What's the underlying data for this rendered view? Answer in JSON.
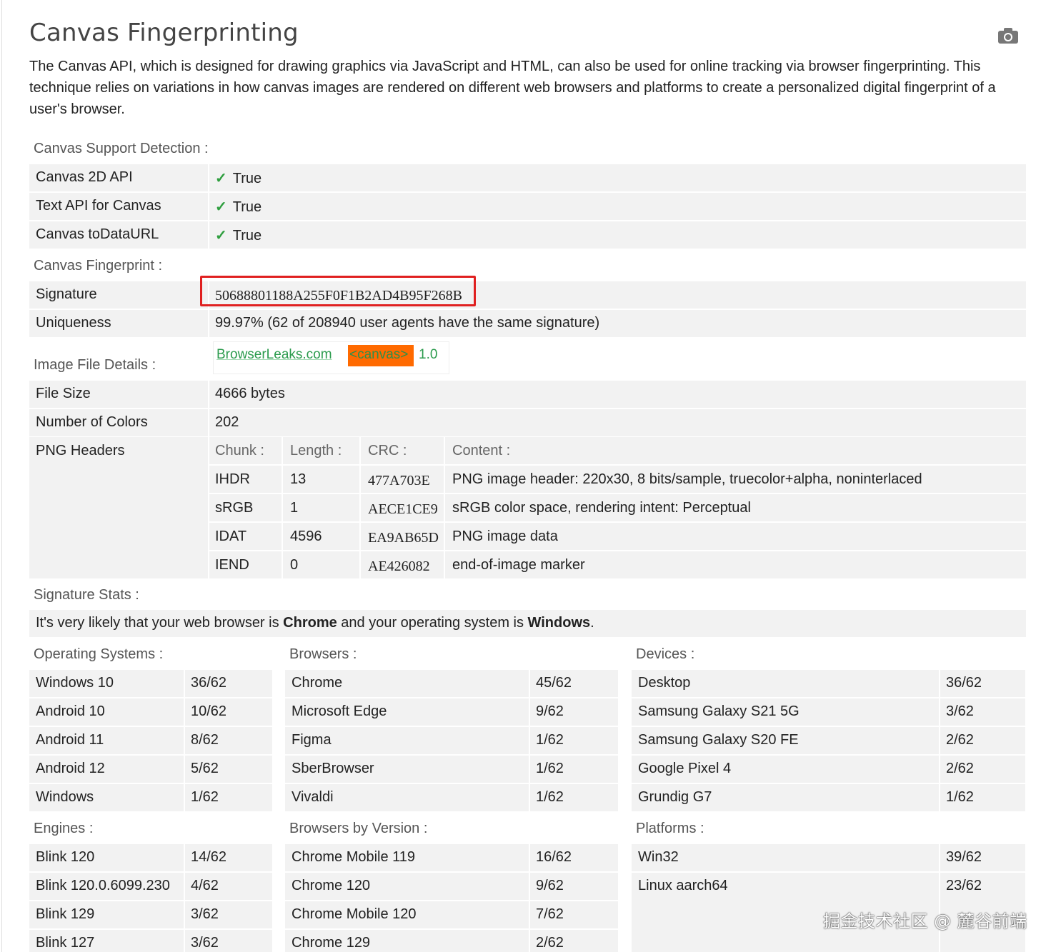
{
  "title": "Canvas Fingerprinting",
  "camera_icon": "camera-icon",
  "intro": "The Canvas API, which is designed for drawing graphics via JavaScript and HTML, can also be used for online tracking via browser fingerprinting. This technique relies on variations in how canvas images are rendered on different web browsers and platforms to create a personalized digital fingerprint of a user's browser.",
  "support": {
    "heading": "Canvas Support Detection :",
    "rows": [
      {
        "key": "Canvas 2D API",
        "check": "✓",
        "value": "True"
      },
      {
        "key": "Text API for Canvas",
        "check": "✓",
        "value": "True"
      },
      {
        "key": "Canvas toDataURL",
        "check": "✓",
        "value": "True"
      }
    ]
  },
  "fingerprint": {
    "heading": "Canvas Fingerprint :",
    "signature_label": "Signature",
    "signature_value": "50688801188A255F0F1B2AD4B95F268B",
    "uniqueness_label": "Uniqueness",
    "uniqueness_value": "99.97% (62 of 208940 user agents have the same signature)"
  },
  "image": {
    "heading": "Image File Details :",
    "banner_site": "BrowserLeaks.com",
    "banner_tag": "<canvas>",
    "banner_version": "1.0",
    "file_size_label": "File Size",
    "file_size_value": "4666 bytes",
    "colors_label": "Number of Colors",
    "colors_value": "202",
    "png_label": "PNG Headers",
    "png_headers": [
      "Chunk :",
      "Length :",
      "CRC :",
      "Content :"
    ],
    "png_rows": [
      [
        "IHDR",
        "13",
        "477A703E",
        "PNG image header: 220x30, 8 bits/sample, truecolor+alpha, noninterlaced"
      ],
      [
        "sRGB",
        "1",
        "AECE1CE9",
        "sRGB color space, rendering intent: Perceptual"
      ],
      [
        "IDAT",
        "4596",
        "EA9AB65D",
        "PNG image data"
      ],
      [
        "IEND",
        "0",
        "AE426082",
        "end-of-image marker"
      ]
    ]
  },
  "stats": {
    "heading": "Signature Stats :",
    "text_a": "It's very likely that your web browser is ",
    "browser": "Chrome",
    "text_b": " and your operating system is ",
    "os": "Windows",
    "text_c": "."
  },
  "groups": {
    "os": {
      "heading": "Operating Systems :",
      "rows": [
        [
          "Windows 10",
          "36/62"
        ],
        [
          "Android 10",
          "10/62"
        ],
        [
          "Android 11",
          "8/62"
        ],
        [
          "Android 12",
          "5/62"
        ],
        [
          "Windows",
          "1/62"
        ]
      ]
    },
    "browsers": {
      "heading": "Browsers :",
      "rows": [
        [
          "Chrome",
          "45/62"
        ],
        [
          "Microsoft Edge",
          "9/62"
        ],
        [
          "Figma",
          "1/62"
        ],
        [
          "SberBrowser",
          "1/62"
        ],
        [
          "Vivaldi",
          "1/62"
        ]
      ]
    },
    "devices": {
      "heading": "Devices :",
      "rows": [
        [
          "Desktop",
          "36/62"
        ],
        [
          "Samsung Galaxy S21 5G",
          "3/62"
        ],
        [
          "Samsung Galaxy S20 FE",
          "2/62"
        ],
        [
          "Google Pixel 4",
          "2/62"
        ],
        [
          "Grundig G7",
          "1/62"
        ]
      ]
    },
    "engines": {
      "heading": "Engines :",
      "rows": [
        [
          "Blink 120",
          "14/62"
        ],
        [
          "Blink 120.0.6099.230",
          "4/62"
        ],
        [
          "Blink 129",
          "3/62"
        ],
        [
          "Blink 127",
          "3/62"
        ]
      ]
    },
    "versions": {
      "heading": "Browsers by Version :",
      "rows": [
        [
          "Chrome Mobile 119",
          "16/62"
        ],
        [
          "Chrome 120",
          "9/62"
        ],
        [
          "Chrome Mobile 120",
          "7/62"
        ],
        [
          "Chrome 129",
          "2/62"
        ]
      ]
    },
    "platforms": {
      "heading": "Platforms :",
      "rows": [
        [
          "Win32",
          "39/62"
        ],
        [
          "Linux aarch64",
          "23/62"
        ]
      ]
    }
  },
  "watermark": "掘金技术社区 @ 麓谷前端",
  "colors": {
    "check": "#2e9e3e",
    "highlight_box": "#e02020",
    "banner_tag_bg": "#ff6a00",
    "row_bg": "#f2f2f2"
  }
}
